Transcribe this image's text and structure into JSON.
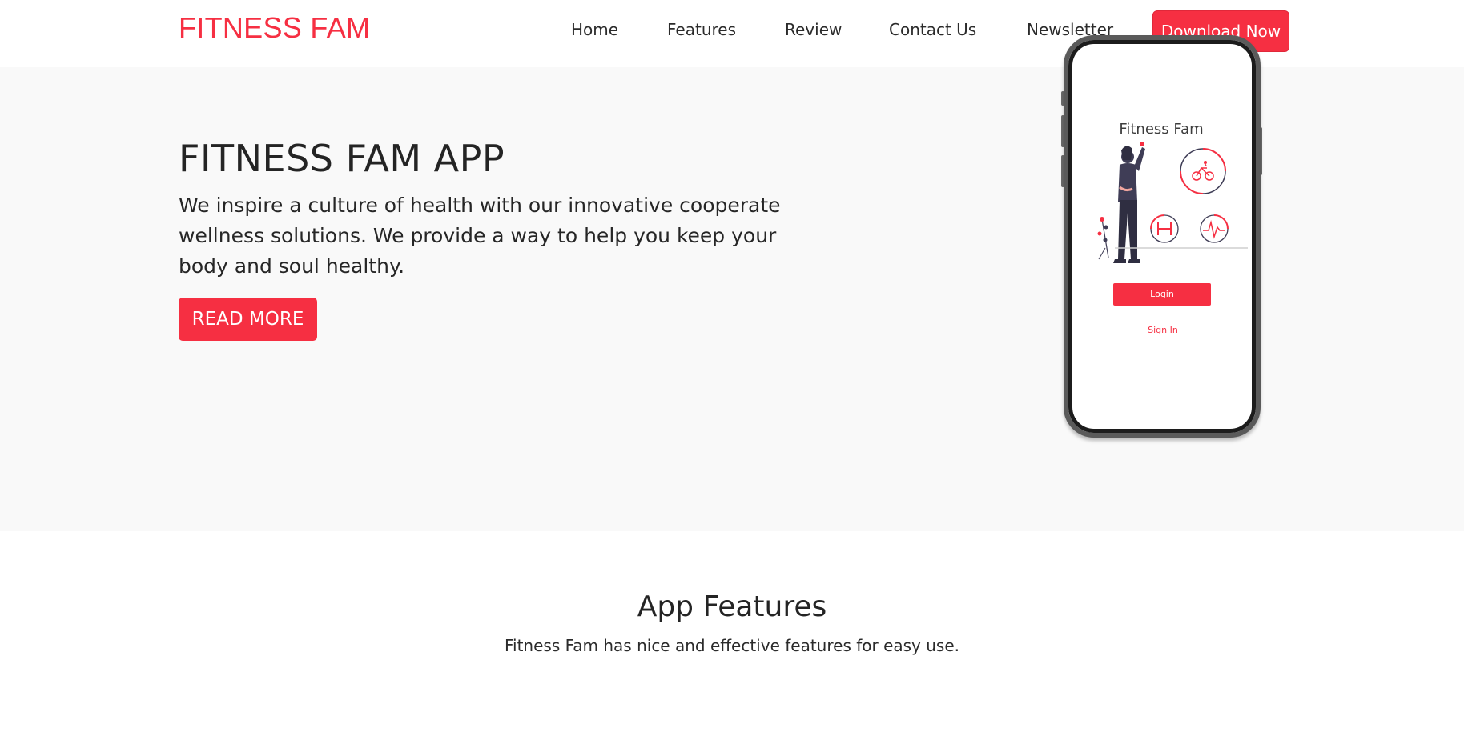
{
  "brand": {
    "name": "FITNESS FAM",
    "color": "#f62f42"
  },
  "nav": {
    "items": [
      {
        "label": "Home"
      },
      {
        "label": "Features"
      },
      {
        "label": "Review"
      },
      {
        "label": "Contact Us"
      },
      {
        "label": "Newsletter"
      }
    ],
    "cta_label": "Download Now"
  },
  "hero": {
    "title": "FITNESS FAM APP",
    "text": "We inspire a culture of health with our innovative cooperate wellness solutions. We provide a way to help you keep your body and soul healthy.",
    "button_label": "READ MORE",
    "phone": {
      "screen_title": "Fitness Fam",
      "login_label": "Login",
      "signin_label": "Sign In"
    }
  },
  "features": {
    "title": "App Features",
    "subtitle": "Fitness Fam has nice and effective features for easy use."
  },
  "icons": {
    "bicycle": "bicycle-icon",
    "dumbbell": "dumbbell-icon",
    "heartbeat": "heartbeat-icon"
  },
  "colors": {
    "accent": "#f62f42",
    "hero_bg": "#f9f9f9",
    "text": "#242424"
  }
}
